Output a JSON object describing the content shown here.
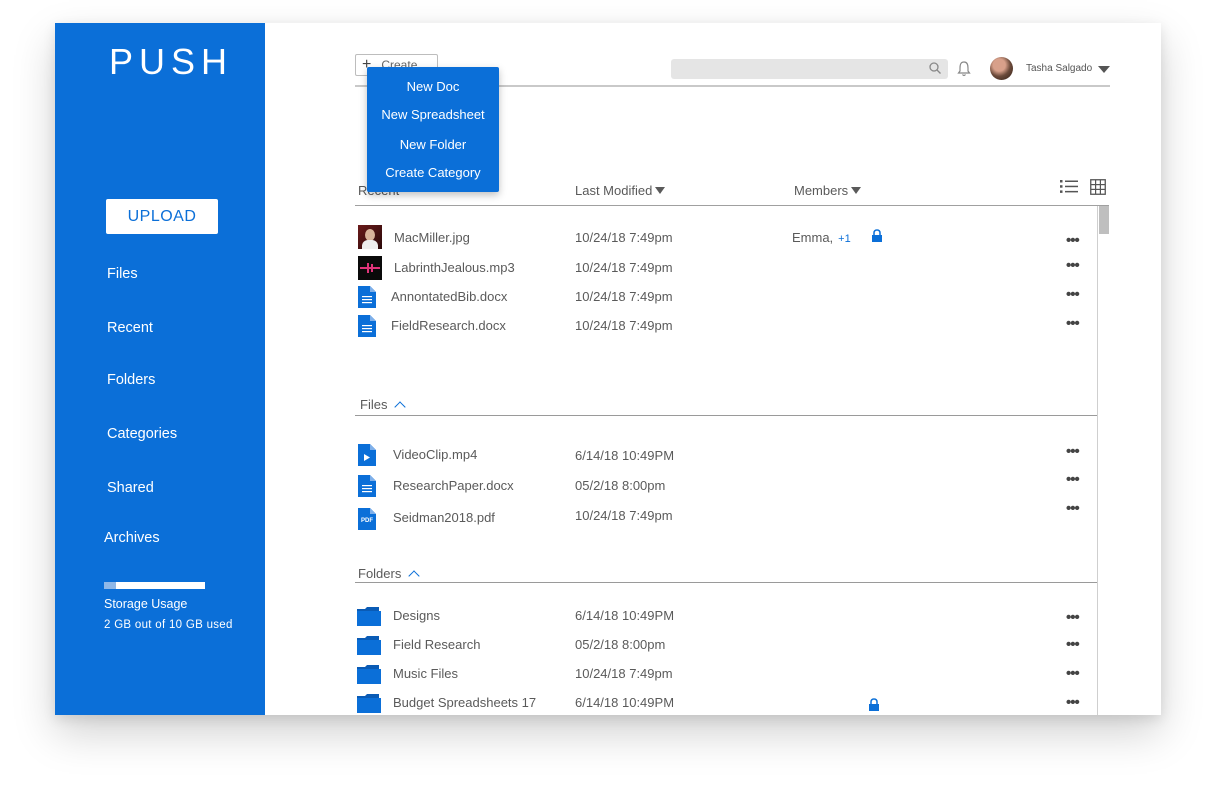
{
  "sidebar": {
    "logo": "PUSH",
    "upload_label": "UPLOAD",
    "nav": [
      "Files",
      "Recent",
      "Folders",
      "Categories",
      "Shared",
      "Archives"
    ],
    "storage_label": "Storage Usage",
    "storage_value": "2 GB out of 10 GB used",
    "storage_fraction": 0.12
  },
  "header": {
    "create_label": "Create",
    "search_placeholder": "",
    "user_name": "Tasha Salgado"
  },
  "create_menu": [
    "New Doc",
    "New Spreadsheet",
    "New Folder",
    "Create Category"
  ],
  "columns": {
    "recent": "Recent",
    "last_modified": "Last Modified",
    "members": "Members"
  },
  "recent_rows": [
    {
      "name": "MacMiller.jpg",
      "date": "10/24/18 7:49pm",
      "members": "Emma,",
      "members_more": "+1"
    },
    {
      "name": "LabrinthJealous.mp3",
      "date": "10/24/18 7:49pm"
    },
    {
      "name": "AnnontatedBib.docx",
      "date": "10/24/18 7:49pm"
    },
    {
      "name": "FieldResearch.docx",
      "date": "10/24/18 7:49pm"
    }
  ],
  "files_section": {
    "title": "Files",
    "rows": [
      {
        "name": "VideoClip.mp4",
        "date": "6/14/18 10:49PM"
      },
      {
        "name": "ResearchPaper.docx",
        "date": "05/2/18 8:00pm"
      },
      {
        "name": "Seidman2018.pdf",
        "date": "10/24/18 7:49pm"
      }
    ]
  },
  "folders_section": {
    "title": "Folders",
    "rows": [
      {
        "name": "Designs",
        "date": "6/14/18 10:49PM"
      },
      {
        "name": "Field Research",
        "date": "05/2/18 8:00pm"
      },
      {
        "name": "Music Files",
        "date": "10/24/18 7:49pm"
      },
      {
        "name": "Budget Spreadsheets 17",
        "date": "6/14/18 10:49PM"
      }
    ]
  },
  "dots_label": "•••",
  "pdf_label": "PDF",
  "colors": {
    "accent": "#0b6fd8"
  }
}
